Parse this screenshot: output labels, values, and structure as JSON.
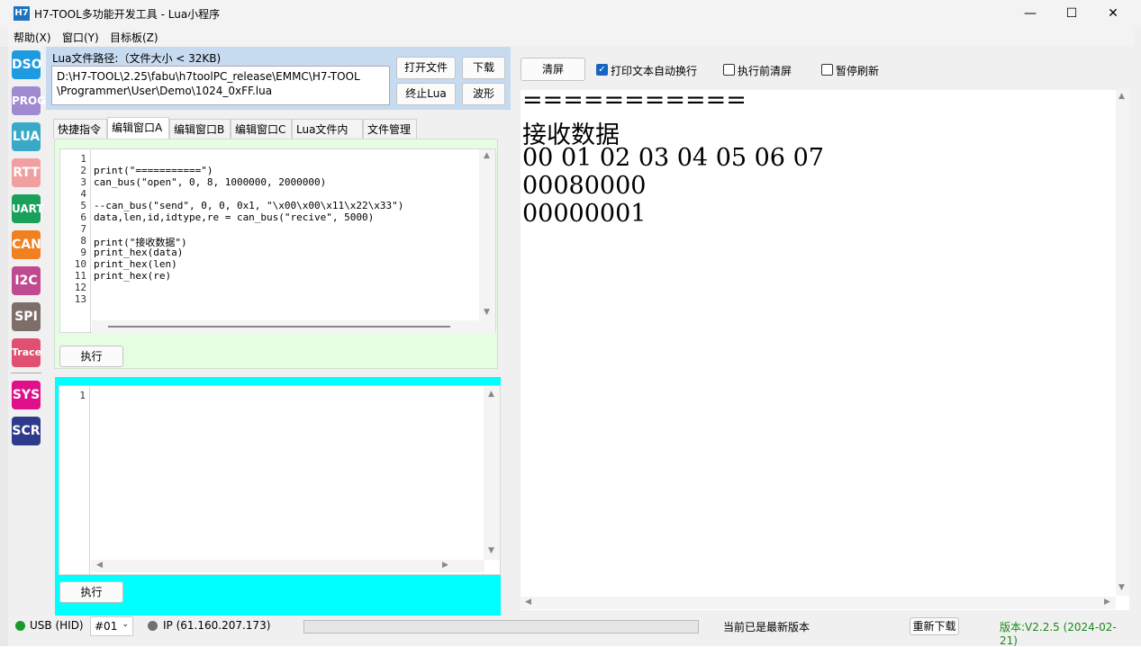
{
  "app": {
    "icon_text": "H7",
    "title": "H7-TOOL多功能开发工具 - Lua小程序",
    "minimize": "—",
    "maximize": "☐",
    "close": "✕"
  },
  "menu": [
    "帮助(X)",
    "窗口(Y)",
    "目标板(Z)"
  ],
  "sidebar": [
    {
      "label": "DSO",
      "color": "#1e9be0"
    },
    {
      "label": "PROG",
      "color": "#a08ad0"
    },
    {
      "label": "LUA",
      "color": "#3aa9c8"
    },
    {
      "label": "RTT",
      "color": "#f0a0a0"
    },
    {
      "label": "UART",
      "color": "#1aa05a"
    },
    {
      "label": "CAN",
      "color": "#f08020"
    },
    {
      "label": "I2C",
      "color": "#c04a90"
    },
    {
      "label": "SPI",
      "color": "#7d6e6a"
    },
    {
      "label": "Trace",
      "color": "#e05070"
    },
    {
      "label": "SYS",
      "color": "#e0108a"
    },
    {
      "label": "SCR",
      "color": "#303a8c"
    }
  ],
  "lua_file": {
    "label": "Lua文件路径:（文件大小 < 32KB)",
    "path_line1": "D:\\H7-TOOL\\2.25\\fabu\\h7toolPC_release\\EMMC\\H7-TOOL",
    "path_line2": "\\Programmer\\User\\Demo\\1024_0xFF.lua",
    "open_button": "打开文件",
    "download_button": "下载",
    "stop_button": "终止Lua",
    "wave_button": "波形"
  },
  "tabs": [
    "快捷指令",
    "编辑窗口A",
    "编辑窗口B",
    "编辑窗口C",
    "Lua文件内容",
    "文件管理"
  ],
  "editor_a": {
    "line_numbers": [
      "1",
      "2",
      "3",
      "4",
      "5",
      "6",
      "7",
      "8",
      "9",
      "10",
      "11",
      "12",
      "13"
    ],
    "lines": [
      "",
      "print(\"===========\")",
      "can_bus(\"open\", 0, 8, 1000000, 2000000)",
      "",
      "--can_bus(\"send\", 0, 0, 0x1, \"\\x00\\x00\\x11\\x22\\x33\")",
      "data,len,id,idtype,re = can_bus(\"recive\", 5000)",
      "",
      "print(\"接收数据\")",
      "print_hex(data)",
      "print_hex(len)",
      "print_hex(re)",
      "",
      ""
    ],
    "run_button": "执行"
  },
  "editor_b": {
    "line_numbers": [
      "1"
    ],
    "run_button": "执行"
  },
  "output_panel": {
    "clear_button": "清屏",
    "wrap_label": "打印文本自动换行",
    "wrap_checked": true,
    "clear_before_label": "执行前清屏",
    "clear_before_checked": false,
    "pause_label": "暂停刷新",
    "pause_checked": false,
    "lines": [
      "===========",
      "接收数据",
      "00 01 02 03 04 05 06 07",
      "00080000",
      "00000001"
    ]
  },
  "status": {
    "usb": "USB (HID)",
    "device": "#01",
    "ip": "IP (61.160.207.173)",
    "update_text": "当前已是最新版本",
    "redownload": "重新下载",
    "version": "版本:V2.2.5 (2024-02-21)",
    "usb_dot_color": "#1a9a2a",
    "ip_dot_color": "#707070",
    "version_color": "#1a8a1a"
  }
}
